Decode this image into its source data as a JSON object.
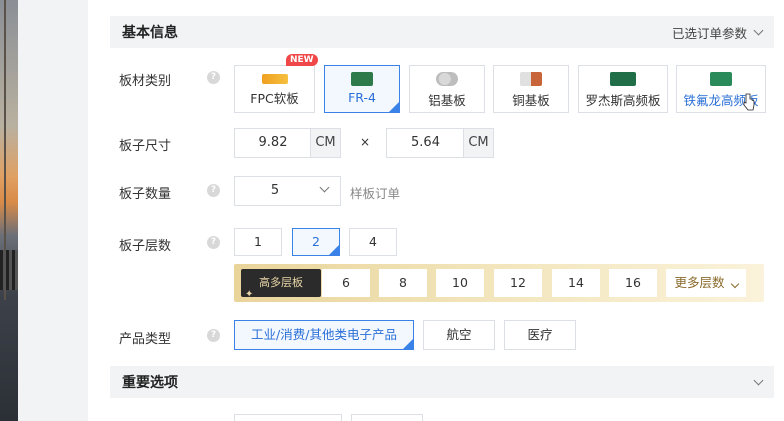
{
  "basic": {
    "title": "基本信息",
    "selected_params": "已选订单参数"
  },
  "material": {
    "label": "板材类别",
    "new_badge": "NEW",
    "options": [
      {
        "label": "FPC软板",
        "selected": false
      },
      {
        "label": "FR-4",
        "selected": true
      },
      {
        "label": "铝基板",
        "selected": false
      },
      {
        "label": "铜基板",
        "selected": false
      },
      {
        "label": "罗杰斯高频板",
        "selected": false
      },
      {
        "label": "铁氟龙高频板",
        "selected": false
      }
    ]
  },
  "size": {
    "label": "板子尺寸",
    "width": "9.82",
    "height": "5.64",
    "unit": "CM",
    "times": "×"
  },
  "quantity": {
    "label": "板子数量",
    "value": "5",
    "note": "样板订单"
  },
  "layers": {
    "label": "板子层数",
    "basic_options": [
      "1",
      "2",
      "4"
    ],
    "selected": "2",
    "high_tag": "高多层板",
    "high_options": [
      "6",
      "8",
      "10",
      "12",
      "14",
      "16"
    ],
    "more": "更多层数"
  },
  "product": {
    "label": "产品类型",
    "options": [
      "工业/消费/其他类电子产品",
      "航空",
      "医疗"
    ],
    "selected": "工业/消费/其他类电子产品"
  },
  "important": {
    "title": "重要选项"
  },
  "help_symbol": "?",
  "icons": [
    "help-icon",
    "chevron-down-icon",
    "sparkle-icon",
    "pointer-cursor-icon"
  ]
}
